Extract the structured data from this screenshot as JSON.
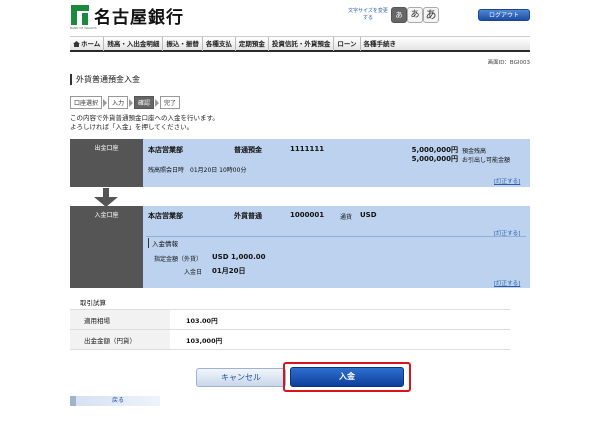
{
  "header": {
    "bank_name": "名古屋銀行",
    "bank_sub": "BANK OF NAGOYA",
    "font_size_label": "文字サイズを変更する",
    "font_sizes": [
      "あ",
      "あ",
      "あ"
    ],
    "logout_label": "ログアウト"
  },
  "nav": {
    "items": [
      "ホーム",
      "残高・入出金明細",
      "振込・振替",
      "各種支払",
      "定期預金",
      "投資信託・外貨預金",
      "ローン",
      "各種手続き"
    ]
  },
  "screen_id": "画面ID：BGI003",
  "page_title": "外貨普通預金入金",
  "steps": [
    "口座選択",
    "入力",
    "確認",
    "完了"
  ],
  "current_step": "確認",
  "instructions": [
    "この内容で外貨普通預金口座への入金を行います。",
    "よろしければ「入金」を押してください。"
  ],
  "withdraw_panel": {
    "label": "出金口座",
    "branch": "本店営業部",
    "account_type": "普通預金",
    "account_number": "1111111",
    "balance": "5,000,000円",
    "balance_label": "預金残高",
    "available": "5,000,000円",
    "available_label": "お引出し可能金額",
    "inquiry_datetime": "残高照会日時　01月20日 10時00分",
    "correct_link": "[訂正する]"
  },
  "deposit_panel": {
    "label": "入金口座",
    "branch": "本店営業部",
    "account_type": "外貨普通",
    "account_number": "1000001",
    "currency_label": "通貨",
    "currency": "USD",
    "correct_link": "[訂正する]",
    "info_title": "入金情報",
    "amount_label": "指定金額（外貨）",
    "amount": "USD 1,000.00",
    "date_label": "入金日",
    "date": "01月20日",
    "info_correct_link": "[訂正する]"
  },
  "calc": {
    "title": "取引試算",
    "rows": [
      {
        "label": "適用相場",
        "value": "103.00円"
      },
      {
        "label": "出金金額（円貨）",
        "value": "103,000円"
      }
    ]
  },
  "buttons": {
    "cancel": "キャンセル",
    "submit": "入金",
    "back": "戻る"
  },
  "colors": {
    "panel_bg": "#bcd2ee",
    "panel_label_bg": "#555555",
    "primary_button": "#1d4fa3",
    "highlight": "#d9141e",
    "logo_green": "#1a8a3c"
  }
}
